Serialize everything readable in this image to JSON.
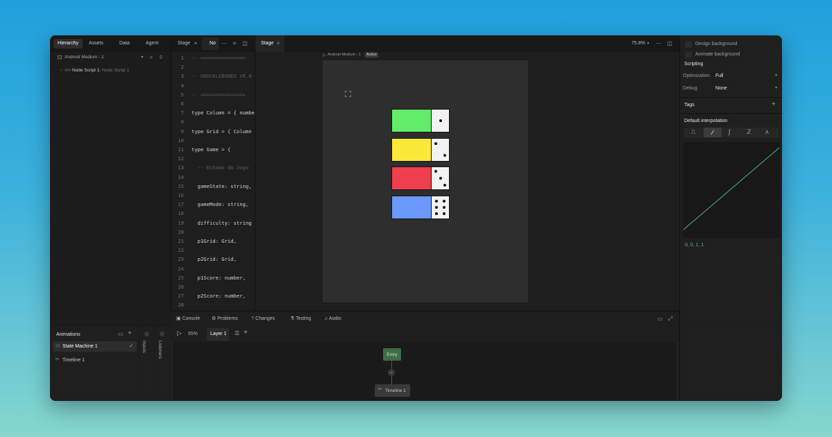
{
  "left_panel": {
    "tabs": [
      "Hierarchy",
      "Assets",
      "Data",
      "Agent"
    ],
    "artboard_label": "Android Medium - 1",
    "tree_item_name": "Node Script 1:",
    "tree_item_type": "Node Script 1"
  },
  "code_panel": {
    "tabs": [
      "Stage",
      "No"
    ],
    "lines": [
      {
        "n": "1",
        "text": "-- ===============",
        "kind": "comment"
      },
      {
        "n": "2",
        "text": "",
        "kind": "plain"
      },
      {
        "n": "3",
        "text": "-- KNUCKLEBONES V8.0",
        "kind": "comment"
      },
      {
        "n": "4",
        "text": "",
        "kind": "plain"
      },
      {
        "n": "5",
        "text": "-- ===============",
        "kind": "comment"
      },
      {
        "n": "6",
        "text": "",
        "kind": "plain"
      },
      {
        "n": "7",
        "text": "type Column = { numbe",
        "kind": "plain"
      },
      {
        "n": "8",
        "text": "",
        "kind": "plain"
      },
      {
        "n": "9",
        "text": "type Grid = { Column",
        "kind": "plain"
      },
      {
        "n": "10",
        "text": "",
        "kind": "plain"
      },
      {
        "n": "11",
        "text": "type Game = {",
        "kind": "plain"
      },
      {
        "n": "12",
        "text": "",
        "kind": "plain"
      },
      {
        "n": "13",
        "text": "  -- Estado do Jogo",
        "kind": "comment"
      },
      {
        "n": "14",
        "text": "",
        "kind": "plain"
      },
      {
        "n": "15",
        "text": "  gameState: string,",
        "kind": "field"
      },
      {
        "n": "16",
        "text": "",
        "kind": "plain"
      },
      {
        "n": "17",
        "text": "  gameMode: string,",
        "kind": "field"
      },
      {
        "n": "18",
        "text": "",
        "kind": "plain"
      },
      {
        "n": "19",
        "text": "  difficulty: string",
        "kind": "field"
      },
      {
        "n": "20",
        "text": "",
        "kind": "plain"
      },
      {
        "n": "21",
        "text": "  p1Grid: Grid,",
        "kind": "field"
      },
      {
        "n": "22",
        "text": "",
        "kind": "plain"
      },
      {
        "n": "23",
        "text": "  p2Grid: Grid,",
        "kind": "field"
      },
      {
        "n": "24",
        "text": "",
        "kind": "plain"
      },
      {
        "n": "25",
        "text": "  p1Score: number,",
        "kind": "field"
      },
      {
        "n": "26",
        "text": "",
        "kind": "plain"
      },
      {
        "n": "27",
        "text": "  p2Score: number,",
        "kind": "field"
      },
      {
        "n": "28",
        "text": "",
        "kind": "plain"
      }
    ]
  },
  "stage": {
    "tab": "Stage",
    "zoom": "75.8%",
    "artboard_name": "Android Medium - 1",
    "artboard_badge": "Active",
    "dominos": [
      {
        "color": "#63ec6a",
        "dice": 1
      },
      {
        "color": "#fce838",
        "dice": 2
      },
      {
        "color": "#ef3f4e",
        "dice": 3
      },
      {
        "color": "#6b98fb",
        "dice": 6
      }
    ]
  },
  "bottom_tabs": [
    "Console",
    "Problems",
    "Changes",
    "Testing",
    "Audio"
  ],
  "right_panel": {
    "design_background": "Design background",
    "animate_background": "Animate background",
    "scripting_title": "Scripting",
    "optimization_label": "Optimization",
    "optimization_value": "Full",
    "debug_label": "Debug",
    "debug_value": "None",
    "tags_title": "Tags",
    "interpolation_title": "Default interpolation",
    "curve_values": "0, 0, 1, 1"
  },
  "animations": {
    "title": "Animations",
    "items": [
      "State Machine 1",
      "Timeline 1"
    ],
    "inputs_label": "Inputs",
    "listeners_label": "Listeners",
    "zoom": "95%",
    "layer": "Layer 1",
    "entry_node": "Entry",
    "timeline_node": "Timeline 1"
  },
  "colors": {
    "accent": "#4fb3a3",
    "entry_node": "#3f6b45"
  }
}
